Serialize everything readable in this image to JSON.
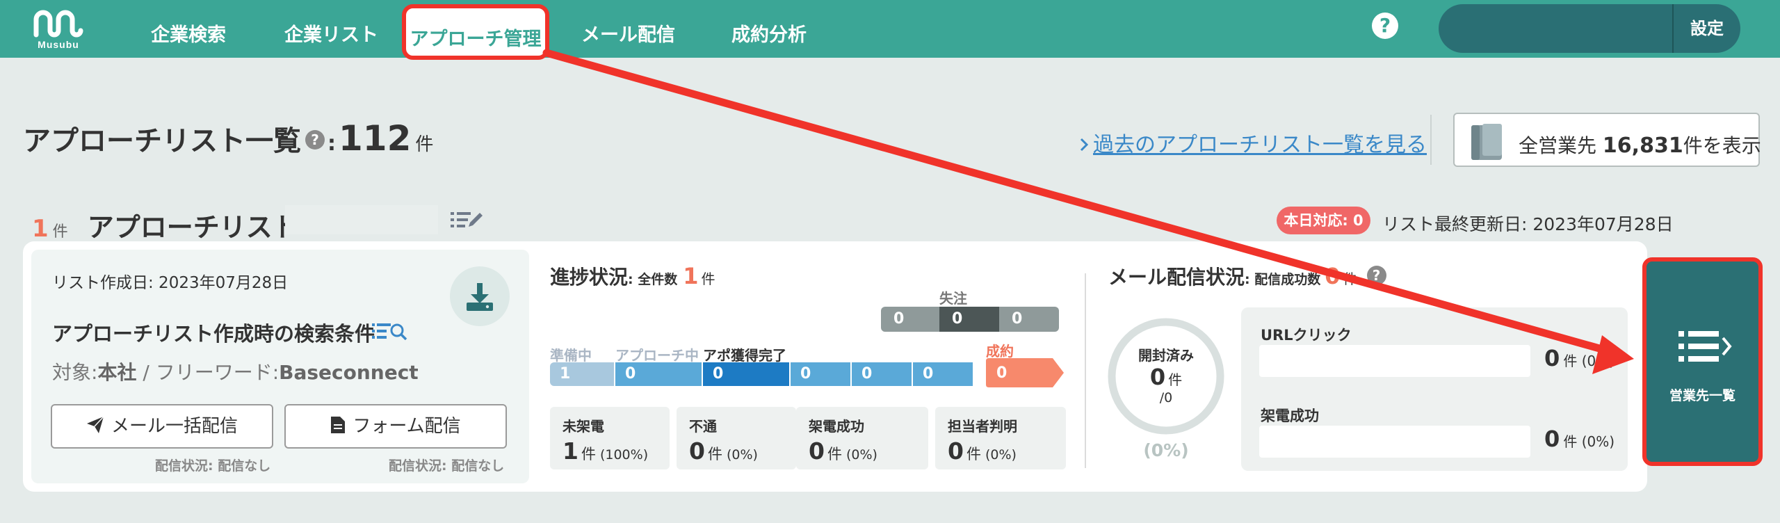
{
  "nav": {
    "logo_text": "Musubu",
    "items": [
      {
        "label": "企業検索"
      },
      {
        "label": "企業リスト"
      },
      {
        "label": "アプローチ管理"
      },
      {
        "label": "メール配信"
      },
      {
        "label": "成約分析"
      }
    ],
    "help_glyph": "?",
    "settings_label": "設定"
  },
  "header": {
    "title": "アプローチリスト一覧",
    "separator": ":",
    "total_count": "112",
    "count_unit": "件",
    "past_link": "過去のアプローチリスト一覧を見る",
    "all_prefix": "全営業先",
    "all_count": "16,831",
    "all_suffix": "件を表示"
  },
  "list": {
    "count": "1",
    "count_unit": "件",
    "title": "アプローチリスト",
    "today_badge": "本日対応: 0",
    "last_updated": "リスト最終更新日: 2023年07月28日"
  },
  "conditions": {
    "created": "リスト作成日: 2023年07月28日",
    "title": "アプローチリスト作成時の検索条件",
    "target_label": "対象:",
    "target_value": "本社",
    "slash": " / ",
    "keyword_label": "フリーワード:",
    "keyword_value": "Baseconnect",
    "mail_button": "メール一括配信",
    "form_button": "フォーム配信",
    "mail_status": "配信状況: 配信なし",
    "form_status": "配信状況: 配信なし"
  },
  "progress": {
    "title": "進捗状況",
    "total_label": ": 全件数",
    "total": "1",
    "unit": "件",
    "lost_label": "失注",
    "lost_cells": [
      "0",
      "0",
      "0"
    ],
    "stage_labels": {
      "prep": "準備中",
      "approaching": "アプローチ中",
      "appointment": "アポ獲得完了",
      "won": "成約"
    },
    "stage_cells": [
      "1",
      "0",
      "0",
      "0",
      "0",
      "0"
    ],
    "won_cell": "0",
    "stats": [
      {
        "label": "未架電",
        "value": "1",
        "unit": "件",
        "pct": "(100%)"
      },
      {
        "label": "不通",
        "value": "0",
        "unit": "件",
        "pct": "(0%)"
      },
      {
        "label": "架電成功",
        "value": "0",
        "unit": "件",
        "pct": "(0%)"
      },
      {
        "label": "担当者判明",
        "value": "0",
        "unit": "件",
        "pct": "(0%)"
      }
    ]
  },
  "mail": {
    "title": "メール配信状況",
    "sent_label": ": 配信成功数",
    "sent": "0",
    "unit": "件",
    "opened_label": "開封済み",
    "opened_value": "0",
    "opened_unit": "件",
    "opened_of": "/0",
    "opened_pct": "(0%)",
    "url_click_label": "URLクリック",
    "url_click_value": "0",
    "url_click_pct": "件 (0%)",
    "call_success_label": "架電成功",
    "call_success_value": "0",
    "call_success_pct": "件 (0%)"
  },
  "side": {
    "sales_list_label": "営業先一覧"
  },
  "colors": {
    "brand": "#3ba696",
    "dark_teal": "#2b7074",
    "annotation_red": "#f0332a",
    "accent_orange": "#f0745a",
    "link_blue": "#3a88c8"
  }
}
